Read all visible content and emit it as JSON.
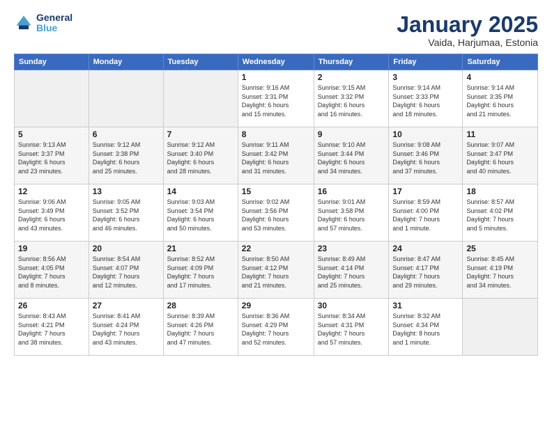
{
  "logo": {
    "line1": "General",
    "line2": "Blue"
  },
  "title": "January 2025",
  "subtitle": "Vaida, Harjumaa, Estonia",
  "weekdays": [
    "Sunday",
    "Monday",
    "Tuesday",
    "Wednesday",
    "Thursday",
    "Friday",
    "Saturday"
  ],
  "weeks": [
    [
      {
        "day": "",
        "info": ""
      },
      {
        "day": "",
        "info": ""
      },
      {
        "day": "",
        "info": ""
      },
      {
        "day": "1",
        "info": "Sunrise: 9:16 AM\nSunset: 3:31 PM\nDaylight: 6 hours\nand 15 minutes."
      },
      {
        "day": "2",
        "info": "Sunrise: 9:15 AM\nSunset: 3:32 PM\nDaylight: 6 hours\nand 16 minutes."
      },
      {
        "day": "3",
        "info": "Sunrise: 9:14 AM\nSunset: 3:33 PM\nDaylight: 6 hours\nand 18 minutes."
      },
      {
        "day": "4",
        "info": "Sunrise: 9:14 AM\nSunset: 3:35 PM\nDaylight: 6 hours\nand 21 minutes."
      }
    ],
    [
      {
        "day": "5",
        "info": "Sunrise: 9:13 AM\nSunset: 3:37 PM\nDaylight: 6 hours\nand 23 minutes."
      },
      {
        "day": "6",
        "info": "Sunrise: 9:12 AM\nSunset: 3:38 PM\nDaylight: 6 hours\nand 25 minutes."
      },
      {
        "day": "7",
        "info": "Sunrise: 9:12 AM\nSunset: 3:40 PM\nDaylight: 6 hours\nand 28 minutes."
      },
      {
        "day": "8",
        "info": "Sunrise: 9:11 AM\nSunset: 3:42 PM\nDaylight: 6 hours\nand 31 minutes."
      },
      {
        "day": "9",
        "info": "Sunrise: 9:10 AM\nSunset: 3:44 PM\nDaylight: 6 hours\nand 34 minutes."
      },
      {
        "day": "10",
        "info": "Sunrise: 9:08 AM\nSunset: 3:46 PM\nDaylight: 6 hours\nand 37 minutes."
      },
      {
        "day": "11",
        "info": "Sunrise: 9:07 AM\nSunset: 3:47 PM\nDaylight: 6 hours\nand 40 minutes."
      }
    ],
    [
      {
        "day": "12",
        "info": "Sunrise: 9:06 AM\nSunset: 3:49 PM\nDaylight: 6 hours\nand 43 minutes."
      },
      {
        "day": "13",
        "info": "Sunrise: 9:05 AM\nSunset: 3:52 PM\nDaylight: 6 hours\nand 46 minutes."
      },
      {
        "day": "14",
        "info": "Sunrise: 9:03 AM\nSunset: 3:54 PM\nDaylight: 6 hours\nand 50 minutes."
      },
      {
        "day": "15",
        "info": "Sunrise: 9:02 AM\nSunset: 3:56 PM\nDaylight: 6 hours\nand 53 minutes."
      },
      {
        "day": "16",
        "info": "Sunrise: 9:01 AM\nSunset: 3:58 PM\nDaylight: 6 hours\nand 57 minutes."
      },
      {
        "day": "17",
        "info": "Sunrise: 8:59 AM\nSunset: 4:00 PM\nDaylight: 7 hours\nand 1 minute."
      },
      {
        "day": "18",
        "info": "Sunrise: 8:57 AM\nSunset: 4:02 PM\nDaylight: 7 hours\nand 5 minutes."
      }
    ],
    [
      {
        "day": "19",
        "info": "Sunrise: 8:56 AM\nSunset: 4:05 PM\nDaylight: 7 hours\nand 8 minutes."
      },
      {
        "day": "20",
        "info": "Sunrise: 8:54 AM\nSunset: 4:07 PM\nDaylight: 7 hours\nand 12 minutes."
      },
      {
        "day": "21",
        "info": "Sunrise: 8:52 AM\nSunset: 4:09 PM\nDaylight: 7 hours\nand 17 minutes."
      },
      {
        "day": "22",
        "info": "Sunrise: 8:50 AM\nSunset: 4:12 PM\nDaylight: 7 hours\nand 21 minutes."
      },
      {
        "day": "23",
        "info": "Sunrise: 8:49 AM\nSunset: 4:14 PM\nDaylight: 7 hours\nand 25 minutes."
      },
      {
        "day": "24",
        "info": "Sunrise: 8:47 AM\nSunset: 4:17 PM\nDaylight: 7 hours\nand 29 minutes."
      },
      {
        "day": "25",
        "info": "Sunrise: 8:45 AM\nSunset: 4:19 PM\nDaylight: 7 hours\nand 34 minutes."
      }
    ],
    [
      {
        "day": "26",
        "info": "Sunrise: 8:43 AM\nSunset: 4:21 PM\nDaylight: 7 hours\nand 38 minutes."
      },
      {
        "day": "27",
        "info": "Sunrise: 8:41 AM\nSunset: 4:24 PM\nDaylight: 7 hours\nand 43 minutes."
      },
      {
        "day": "28",
        "info": "Sunrise: 8:39 AM\nSunset: 4:26 PM\nDaylight: 7 hours\nand 47 minutes."
      },
      {
        "day": "29",
        "info": "Sunrise: 8:36 AM\nSunset: 4:29 PM\nDaylight: 7 hours\nand 52 minutes."
      },
      {
        "day": "30",
        "info": "Sunrise: 8:34 AM\nSunset: 4:31 PM\nDaylight: 7 hours\nand 57 minutes."
      },
      {
        "day": "31",
        "info": "Sunrise: 8:32 AM\nSunset: 4:34 PM\nDaylight: 8 hours\nand 1 minute."
      },
      {
        "day": "",
        "info": ""
      }
    ]
  ]
}
